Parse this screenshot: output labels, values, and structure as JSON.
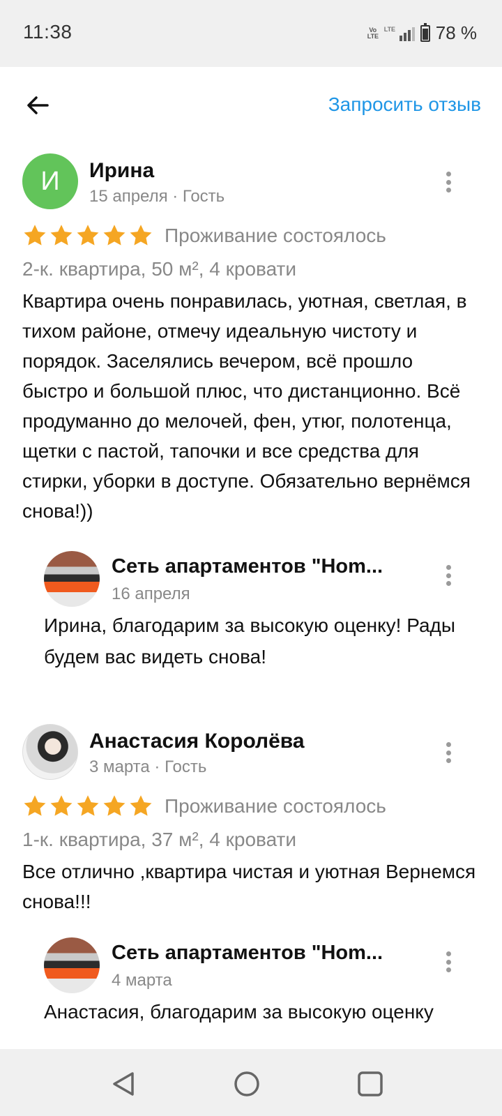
{
  "status_bar": {
    "time": "11:38",
    "volte": "Vo LTE",
    "network": "LTE",
    "battery_percent": "78 %",
    "battery_level": 0.78
  },
  "header": {
    "back_icon": "arrow-left-icon",
    "request_review_label": "Запросить отзыв"
  },
  "reviews": [
    {
      "avatar_letter": "И",
      "author": "Ирина",
      "meta": "15 апреля · Гость",
      "rating": 5,
      "stay_status": "Проживание состоялось",
      "apartment": "2-к. квартира, 50 м², 4 кровати",
      "text": "Квартира очень понравилась, уютная, светлая, в тихом районе, отмечу идеальную чистоту и порядок. Заселялись вечером, всё прошло быстро и большой плюс, что дистанционно. Всё продуманно до мелочей, фен, утюг, полотенца, щетки с пастой, тапочки и все средства для стирки, уборки в доступе. Обязательно вернёмся снова!))",
      "reply": {
        "author": "Сеть апартаментов \"Hom...",
        "date": "16 апреля",
        "text": "Ирина, благодарим за высокую оценку! Рады будем вас видеть снова!"
      }
    },
    {
      "author": "Анастасия Королёва",
      "meta": "3 марта · Гость",
      "rating": 5,
      "stay_status": "Проживание состоялось",
      "apartment": "1-к. квартира, 37 м², 4 кровати",
      "text": "Все отлично ,квартира чистая и уютная Вернемся снова!!!",
      "reply": {
        "author": "Сеть апартаментов \"Hom...",
        "date": "4 марта",
        "text": "Анастасия, благодарим за высокую оценку"
      }
    }
  ],
  "colors": {
    "accent": "#1f96e6",
    "star": "#f5a623",
    "avatar_green": "#62c45a",
    "muted_text": "#888888"
  },
  "nav_bar": {
    "back_icon": "triangle-back-icon",
    "home_icon": "circle-home-icon",
    "recents_icon": "square-recents-icon"
  }
}
